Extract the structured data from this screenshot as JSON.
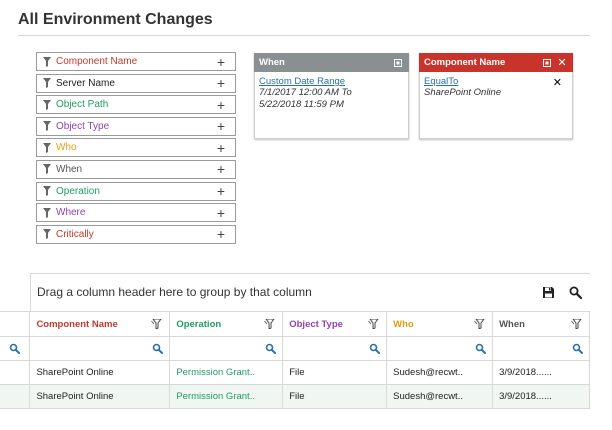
{
  "page": {
    "title": "All Environment Changes"
  },
  "filters": [
    {
      "label": "Component Name",
      "color": "#c0392b"
    },
    {
      "label": "Server Name",
      "color": "#222222"
    },
    {
      "label": "Object Path",
      "color": "#1e9e63"
    },
    {
      "label": "Object Type",
      "color": "#8e44ad"
    },
    {
      "label": "Who",
      "color": "#e39e10"
    },
    {
      "label": "When",
      "color": "#555555"
    },
    {
      "label": "Operation",
      "color": "#1e9e63"
    },
    {
      "label": "Where",
      "color": "#8e44ad"
    },
    {
      "label": "Critically",
      "color": "#c0392b"
    }
  ],
  "cards": {
    "when": {
      "title": "When",
      "header_color": "#8a8f91",
      "condition": "Custom Date Range",
      "values": [
        "7/1/2017 12:00 AM To",
        "5/22/2018 11:59 PM"
      ]
    },
    "component": {
      "title": "Component Name",
      "header_color": "#c8342b",
      "condition": "EqualTo",
      "values": [
        "SharePoint Online"
      ]
    }
  },
  "grid": {
    "group_text": "Drag a column header here to group by that column",
    "columns": [
      {
        "label": "Component Name",
        "color": "#c0392b",
        "width": 140
      },
      {
        "label": "Operation",
        "color": "#1e9e63",
        "width": 113
      },
      {
        "label": "Object Type",
        "color": "#8e44ad",
        "width": 104
      },
      {
        "label": "Who",
        "color": "#e39e10",
        "width": 106
      },
      {
        "label": "When",
        "color": "#555555",
        "width": 97
      }
    ],
    "rows": [
      [
        "SharePoint Online",
        "Permission Grant..",
        "File",
        "Sudesh@recwt..",
        "3/9/2018......"
      ],
      [
        "SharePoint Online",
        "Permission Grant..",
        "File",
        "Sudesh@recwt..",
        "3/9/2018......"
      ]
    ]
  }
}
